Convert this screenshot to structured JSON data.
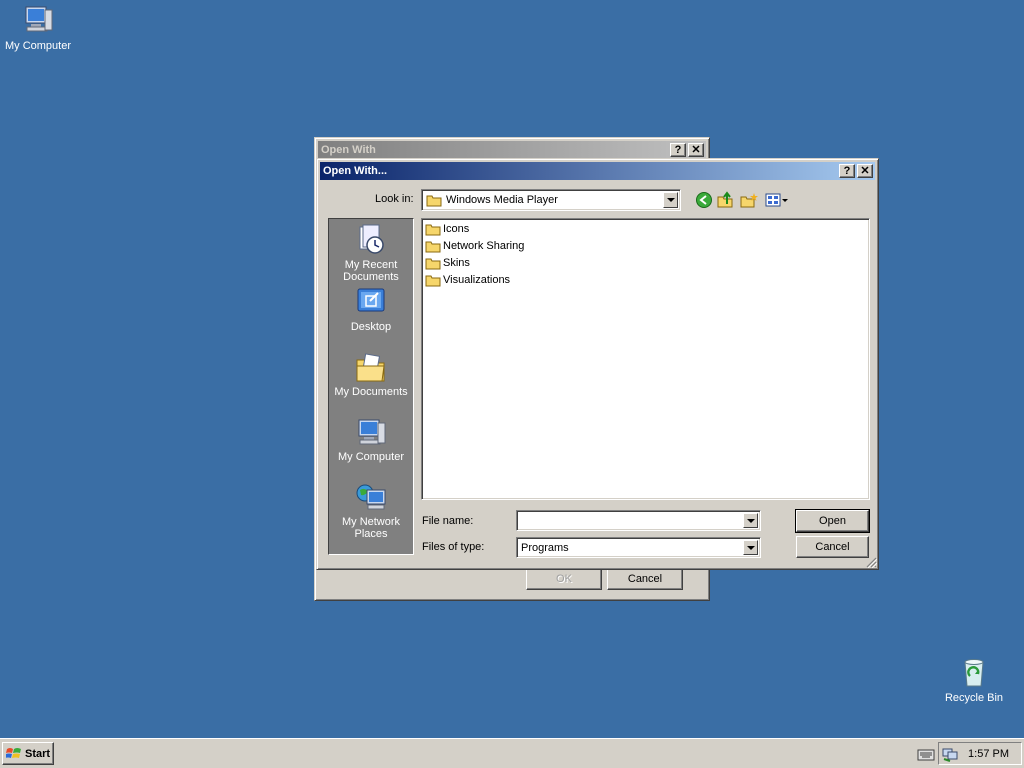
{
  "desktop": {
    "icons": [
      {
        "label": "My Computer",
        "icon": "my-computer-icon"
      },
      {
        "label": "Recycle Bin",
        "icon": "recycle-bin-icon"
      }
    ]
  },
  "back_dialog": {
    "title": "Open With",
    "help_label": "?",
    "close_label": "✕",
    "ok_label": "OK",
    "cancel_label": "Cancel"
  },
  "dialog": {
    "title": "Open With...",
    "help_label": "?",
    "close_label": "✕",
    "look_in_label": "Look in:",
    "look_in_value": "Windows Media Player",
    "toolbar_icons": [
      "back-icon",
      "up-folder-icon",
      "new-folder-icon",
      "views-menu-icon"
    ],
    "places": [
      {
        "label": "My Recent Documents",
        "icon": "my-recent-documents-icon"
      },
      {
        "label": "Desktop",
        "icon": "desktop-icon"
      },
      {
        "label": "My Documents",
        "icon": "my-documents-icon"
      },
      {
        "label": "My Computer",
        "icon": "my-computer-icon"
      },
      {
        "label": "My Network Places",
        "icon": "my-network-places-icon"
      }
    ],
    "files": [
      "Icons",
      "Network Sharing",
      "Skins",
      "Visualizations"
    ],
    "file_name_label": "File name:",
    "file_name_value": "",
    "files_of_type_label": "Files of type:",
    "files_of_type_value": "Programs",
    "open_label": "Open",
    "cancel_label": "Cancel"
  },
  "taskbar": {
    "start_label": "Start",
    "clock": "1:57 PM",
    "tray_icons": [
      "keyboard-icon",
      "network-connection-icon"
    ]
  }
}
